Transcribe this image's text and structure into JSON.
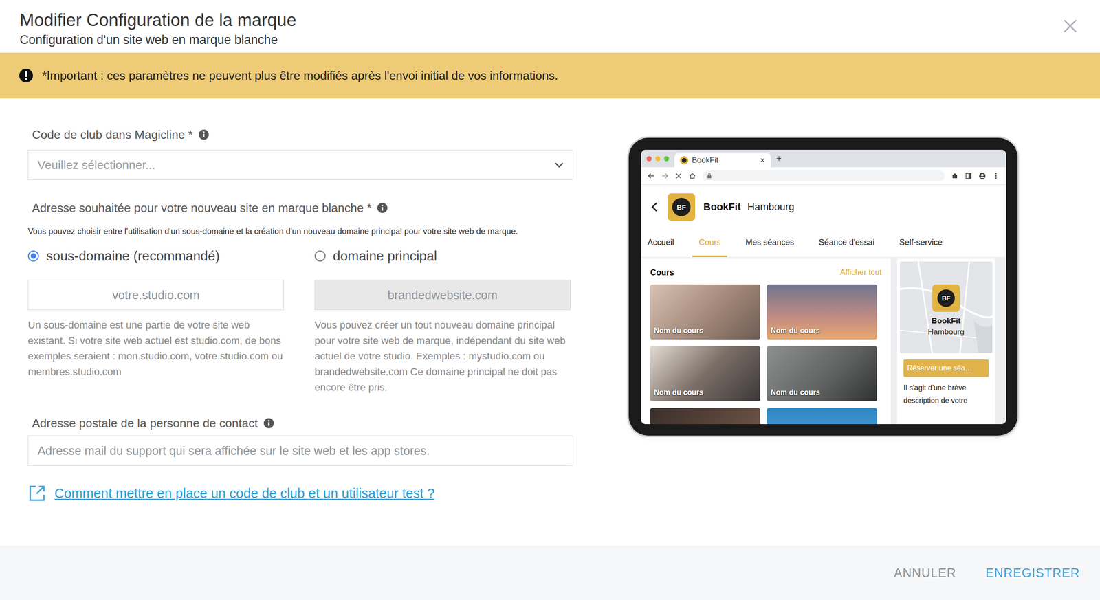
{
  "dialog": {
    "title": "Modifier Configuration de la marque",
    "subtitle": "Configuration d'un site web en marque blanche"
  },
  "banner": {
    "text": "*Important : ces paramètres ne peuvent plus être modifiés après l'envoi initial de vos informations."
  },
  "club_code": {
    "label": "Code de club dans Magicline *",
    "placeholder": "Veuillez sélectionner..."
  },
  "address": {
    "label": "Adresse souhaitée pour votre nouveau site en marque blanche *",
    "hint": "Vous pouvez choisir entre l'utilisation d'un sous-domaine et la création d'un nouveau domaine principal pour votre site web de marque.",
    "options": [
      {
        "label": "sous-domaine (recommandé)",
        "selected": true,
        "disabled": false,
        "placeholder": "votre.studio.com",
        "description": "Un sous-domaine est une partie de votre site web existant. Si votre site web actuel est studio.com, de bons exemples seraient : mon.studio.com, votre.studio.com ou membres.studio.com"
      },
      {
        "label": "domaine principal",
        "selected": false,
        "disabled": true,
        "placeholder": "brandedwebsite.com",
        "description": "Vous pouvez créer un tout nouveau domaine principal pour votre site web de marque, indépendant du site web actuel de votre studio. Exemples : mystudio.com ou brandedwebsite.com Ce domaine principal ne doit pas encore être pris."
      }
    ]
  },
  "contact": {
    "label": "Adresse postale de la personne de contact",
    "placeholder": "Adresse mail du support qui sera affichée sur le site web et les app stores."
  },
  "help_link": "Comment mettre en place un code de club et un utilisateur test ?",
  "preview": {
    "browser_tab": "BookFit",
    "logo": "BF",
    "brand": "BookFit",
    "location": "Hambourg",
    "nav": [
      {
        "label": "Accueil",
        "selected": false
      },
      {
        "label": "Cours",
        "selected": true
      },
      {
        "label": "Mes séances",
        "selected": false
      },
      {
        "label": "Séance d'essai",
        "selected": false
      },
      {
        "label": "Self-service",
        "selected": false
      }
    ],
    "section_title": "Cours",
    "see_all": "Afficher tout",
    "courses": [
      {
        "name": "Nom du cours"
      },
      {
        "name": "Nom du cours"
      },
      {
        "name": "Nom du cours"
      },
      {
        "name": "Nom du cours"
      },
      {
        "name": ""
      },
      {
        "name": ""
      }
    ],
    "card": {
      "brand": "BookFit",
      "location": "Hambourg",
      "button": "Réserver une séa…",
      "description": "Il s'agit d'une brève description de votre"
    }
  },
  "buttons": [
    {
      "label": "ANNULER",
      "primary": false
    },
    {
      "label": "ENREGISTRER",
      "primary": true
    }
  ]
}
